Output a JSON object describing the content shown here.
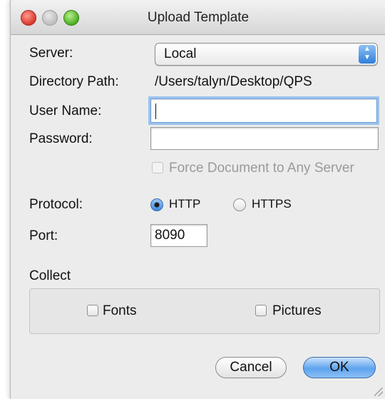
{
  "window": {
    "title": "Upload Template"
  },
  "form": {
    "server_label": "Server:",
    "server_value": "Local",
    "directory_label": "Directory Path:",
    "directory_value": "/Users/talyn/Desktop/QPS",
    "username_label": "User Name:",
    "username_value": "",
    "password_label": "Password:",
    "password_value": "",
    "force_label": "Force Document to Any Server",
    "protocol_label": "Protocol:",
    "protocol_options": [
      "HTTP",
      "HTTPS"
    ],
    "protocol_selected": "HTTP",
    "port_label": "Port:",
    "port_value": "8090"
  },
  "collect": {
    "title": "Collect",
    "fonts_label": "Fonts",
    "pictures_label": "Pictures"
  },
  "buttons": {
    "cancel": "Cancel",
    "ok": "OK"
  },
  "colors": {
    "accent": "#5ea3ef",
    "window_bg": "#ececec"
  }
}
